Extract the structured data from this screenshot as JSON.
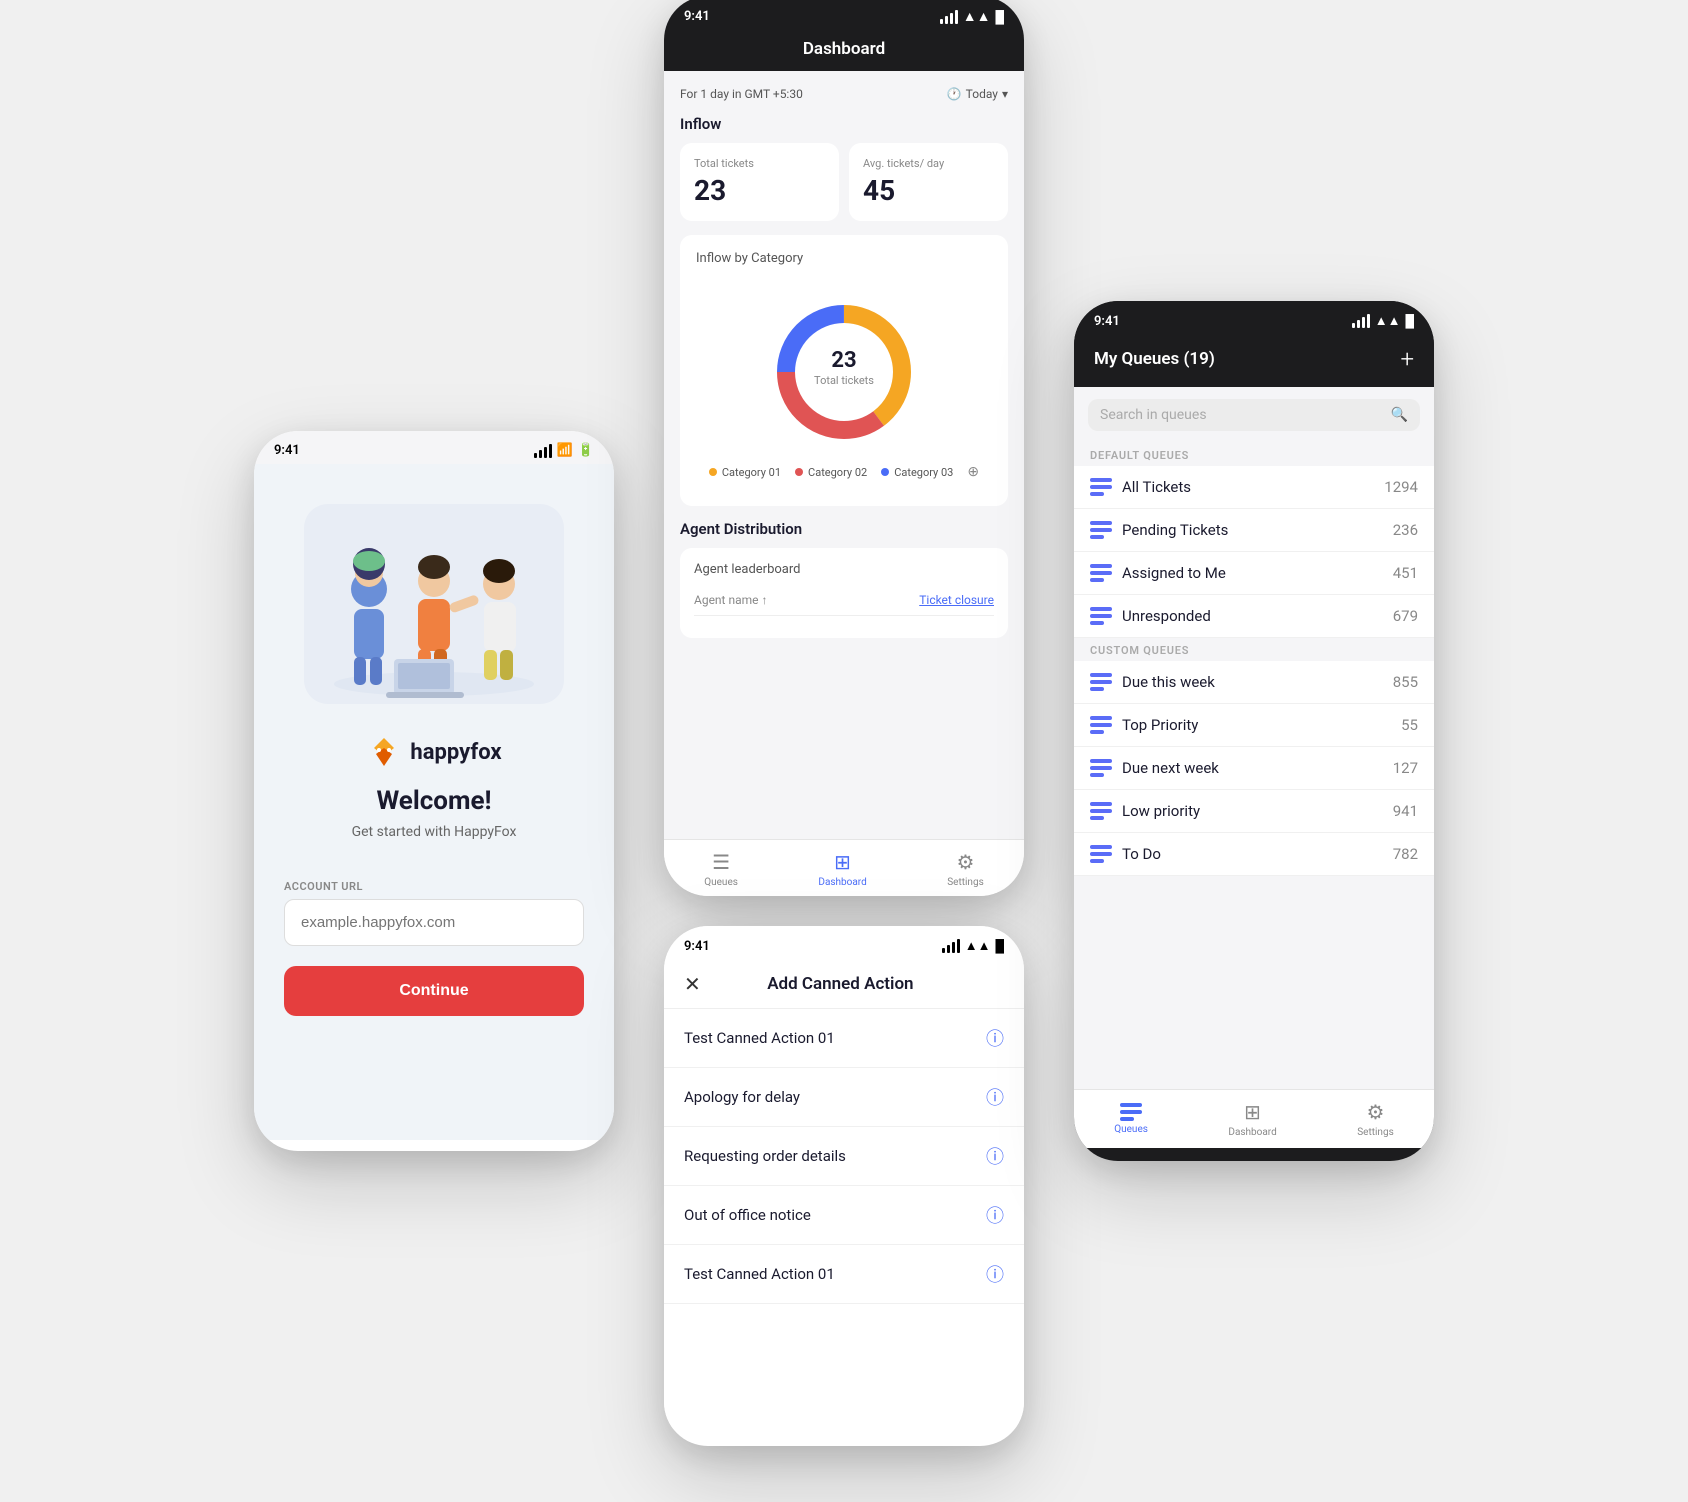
{
  "login": {
    "time": "9:41",
    "brand": "happyfox",
    "welcome_title": "Welcome!",
    "welcome_subtitle": "Get started with HappyFox",
    "input_label": "ACCOUNT URL",
    "input_placeholder": "example.happyfox.com",
    "continue_label": "Continue"
  },
  "dashboard": {
    "time": "9:41",
    "title": "Dashboard",
    "date_info": "For 1 day in GMT +5:30",
    "filter_label": "Today",
    "inflow_label": "Inflow",
    "total_tickets_label": "Total tickets",
    "total_tickets_value": "23",
    "avg_tickets_label": "Avg. tickets/ day",
    "avg_tickets_value": "45",
    "inflow_by_category_label": "Inflow by Category",
    "donut_center_value": "23",
    "donut_center_label": "Total tickets",
    "categories": [
      {
        "name": "Category 01",
        "color": "#f5a623",
        "value": 40
      },
      {
        "name": "Category 02",
        "color": "#e05454",
        "value": 35
      },
      {
        "name": "Category 03",
        "color": "#4a6cf7",
        "value": 25
      }
    ],
    "agent_distribution_label": "Agent Distribution",
    "agent_leaderboard_label": "Agent leaderboard",
    "agent_name_col": "Agent name ↑",
    "ticket_closure_col": "Ticket closure",
    "nav": {
      "queues": "Queues",
      "dashboard": "Dashboard",
      "settings": "Settings"
    }
  },
  "queues": {
    "time": "9:41",
    "title": "My Queues (19)",
    "add_label": "+",
    "search_placeholder": "Search in queues",
    "default_queues_label": "DEFAULT QUEUES",
    "custom_queues_label": "CUSTOM QUEUES",
    "default_items": [
      {
        "name": "All Tickets",
        "count": "1294"
      },
      {
        "name": "Pending Tickets",
        "count": "236"
      },
      {
        "name": "Assigned to Me",
        "count": "451"
      },
      {
        "name": "Unresponded",
        "count": "679"
      }
    ],
    "custom_items": [
      {
        "name": "Due this week",
        "count": "855"
      },
      {
        "name": "Top Priority",
        "count": "55"
      },
      {
        "name": "Due next week",
        "count": "127"
      },
      {
        "name": "Low priority",
        "count": "941"
      },
      {
        "name": "To Do",
        "count": "782"
      }
    ],
    "nav": {
      "queues": "Queues",
      "dashboard": "Dashboard",
      "settings": "Settings"
    }
  },
  "canned": {
    "time": "9:41",
    "title": "Add Canned Action",
    "items": [
      {
        "name": "Test Canned Action 01"
      },
      {
        "name": "Apology for delay"
      },
      {
        "name": "Requesting order details"
      },
      {
        "name": "Out of office notice"
      },
      {
        "name": "Test Canned Action 01"
      }
    ]
  }
}
